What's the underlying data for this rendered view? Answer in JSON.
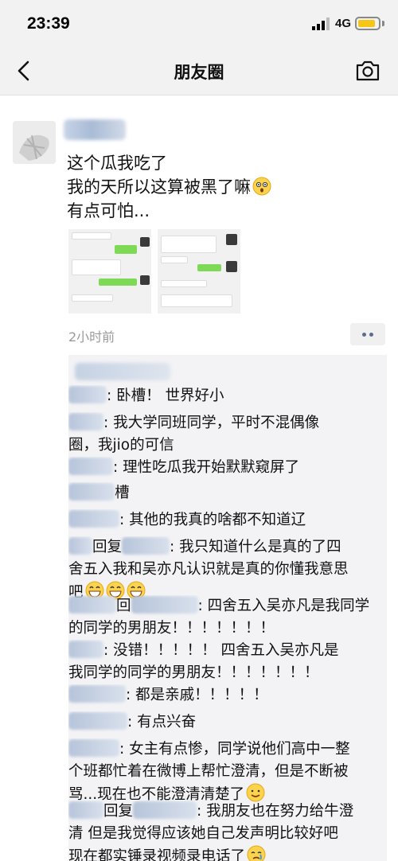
{
  "status_bar": {
    "time": "23:39",
    "network": "4G",
    "battery_color": "#f5c518"
  },
  "nav": {
    "title": "朋友圈",
    "back_icon": "chevron-left-icon",
    "camera_icon": "camera-icon"
  },
  "post": {
    "text_lines": [
      "这个瓜我吃了",
      "我的天所以这算被黑了嘛",
      "有点可怕..."
    ],
    "emoji": "astonished-face-emoji",
    "photo_count": 2,
    "timestamp": "2小时前",
    "more_icon": "more-dots-icon"
  },
  "comments": [
    {
      "lines": [
        ": 卧槽！ 世界好小"
      ]
    },
    {
      "lines": [
        ": 我大学同班同学，平时不混偶像",
        "圈，我jio的可信"
      ]
    },
    {
      "lines": [
        ": 理性吃瓜我开始默默窥屏了"
      ]
    },
    {
      "lines": [
        "槽"
      ]
    },
    {
      "lines": [
        ": 其他的我真的啥都不知道辽"
      ]
    },
    {
      "reply": "回复",
      "lines": [
        ": 我只知道什么是真的了四",
        "舍五入我和吴亦凡认识就是真的你懂我意思",
        "吧"
      ],
      "emoji_count": 3
    },
    {
      "reply": "回",
      "lines": [
        ": 四舍五入吴亦凡是我同学",
        "的同学的男朋友！！！！！！！"
      ]
    },
    {
      "lines": [
        ": 没错！！！！！  四舍五入吴亦凡是",
        "我同学的同学的男朋友！！！！！！！"
      ]
    },
    {
      "lines": [
        ": 都是亲戚！！！！！"
      ]
    },
    {
      "lines": [
        ": 有点兴奋"
      ]
    },
    {
      "lines": [
        ": 女主有点惨，同学说他们高中一整",
        "个班都忙着在微博上帮忙澄清，但是不断被",
        "骂...现在也不能澄清清楚了"
      ],
      "emoji": "smiling-face-emoji"
    },
    {
      "reply": "回复",
      "lines": [
        ": 我朋友也在努力给牛澄",
        "清 但是我觉得应该她自己发声明比较好吧",
        "现在都实锤录视频录电话了"
      ],
      "emoji": "crying-face-emoji"
    }
  ]
}
